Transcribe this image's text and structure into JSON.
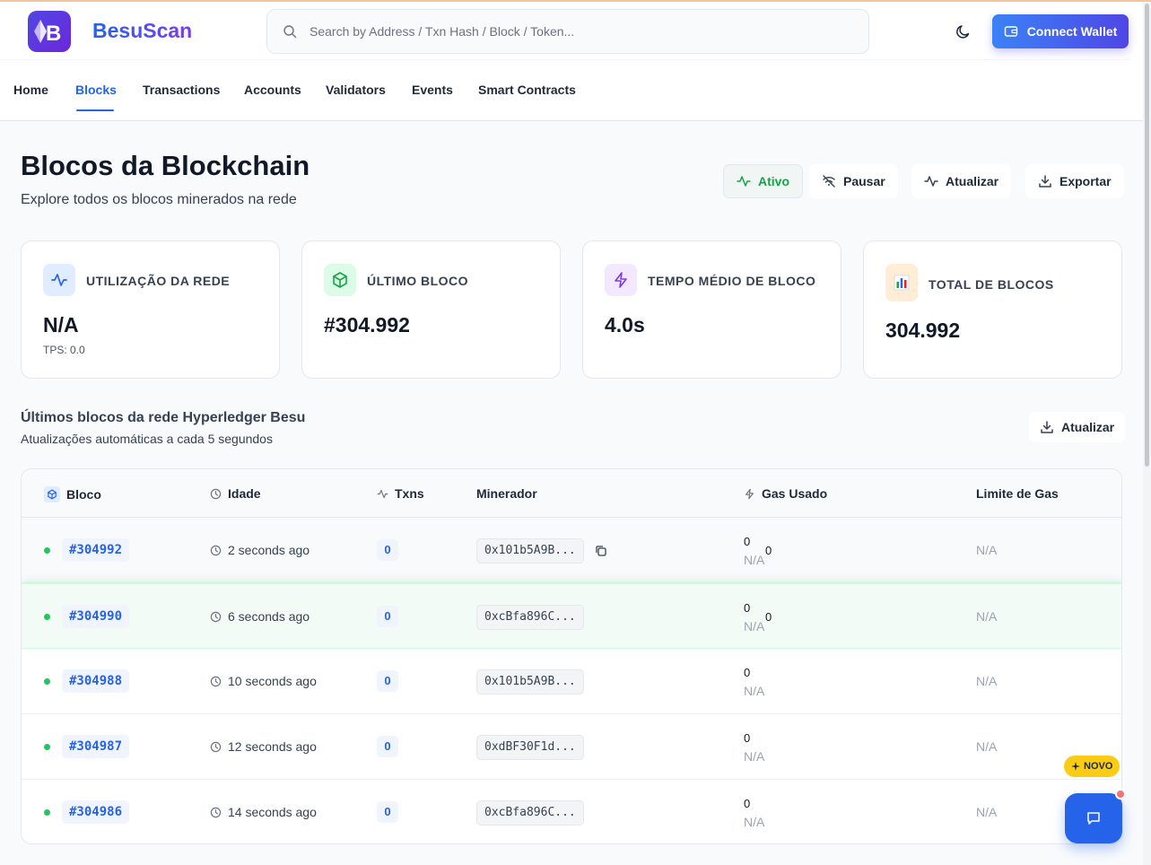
{
  "brand": {
    "logo_letter": "B",
    "name": "BesuScan"
  },
  "search": {
    "placeholder": "Search by Address / Txn Hash / Block / Token..."
  },
  "header": {
    "connect_label": "Connect Wallet"
  },
  "nav": {
    "items": [
      {
        "label": "Home"
      },
      {
        "label": "Blocks",
        "active": true
      },
      {
        "label": "Transactions"
      },
      {
        "label": "Accounts"
      },
      {
        "label": "Validators"
      },
      {
        "label": "Events"
      },
      {
        "label": "Smart Contracts"
      }
    ]
  },
  "page": {
    "title": "Blocos da Blockchain",
    "subtitle": "Explore todos os blocos minerados na rede"
  },
  "toolbar": {
    "ativo": "Ativo",
    "pausar": "Pausar",
    "atualizar": "Atualizar",
    "exportar": "Exportar"
  },
  "stats": [
    {
      "label": "UTILIZAÇÃO DA REDE",
      "value": "N/A",
      "sub": "TPS: 0.0",
      "icon": "activity-icon",
      "color": "#2563eb"
    },
    {
      "label": "ÚLTIMO BLOCO",
      "value": "#304.992",
      "icon": "cube-icon",
      "color": "#16a34a"
    },
    {
      "label": "TEMPO MÉDIO DE BLOCO",
      "value": "4.0s",
      "icon": "lightning-icon",
      "color": "#7c3aed"
    },
    {
      "label": "TOTAL DE BLOCOS",
      "value": "304.992",
      "icon": "bar-chart-icon",
      "color": "#ea580c"
    }
  ],
  "section": {
    "title": "Últimos blocos da rede Hyperledger Besu",
    "subtitle": "Atualizações automáticas a cada 5 segundos",
    "refresh": "Atualizar"
  },
  "table": {
    "headers": {
      "block": "Bloco",
      "age": "Idade",
      "txns": "Txns",
      "miner": "Minerador",
      "gas": "Gas Usado",
      "limit": "Limite de Gas"
    },
    "rows": [
      {
        "block": "#304992",
        "age": "2 seconds ago",
        "txns": "0",
        "miner": "0x101b5A9B...",
        "gas_used": "0",
        "gas_pct": "N/A",
        "gas_extra": "0",
        "limit": "N/A"
      },
      {
        "block": "#304990",
        "age": "6 seconds ago",
        "txns": "0",
        "miner": "0xcBfa896C...",
        "gas_used": "0",
        "gas_pct": "N/A",
        "gas_extra": "0",
        "limit": "N/A"
      },
      {
        "block": "#304988",
        "age": "10 seconds ago",
        "txns": "0",
        "miner": "0x101b5A9B...",
        "gas_used": "0",
        "gas_pct": "N/A",
        "limit": "N/A"
      },
      {
        "block": "#304987",
        "age": "12 seconds ago",
        "txns": "0",
        "miner": "0xdBF30F1d...",
        "gas_used": "0",
        "gas_pct": "N/A",
        "limit": "N/A"
      },
      {
        "block": "#304986",
        "age": "14 seconds ago",
        "txns": "0",
        "miner": "0xcBfa896C...",
        "gas_used": "0",
        "gas_pct": "N/A",
        "limit": "N/A"
      }
    ]
  },
  "badge": {
    "novo": "NOVO"
  },
  "colors": {
    "accent": "#2563eb",
    "status_green": "#22c55e",
    "brand_purple": "#7c3aed"
  }
}
